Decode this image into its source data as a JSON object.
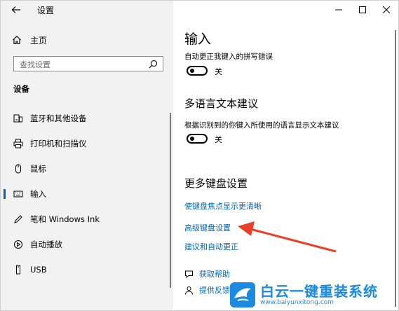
{
  "window": {
    "title": "设置",
    "controls": [
      "minimize-icon",
      "maximize-icon",
      "close-icon"
    ]
  },
  "sidebar": {
    "home_label": "主页",
    "search_placeholder": "查找设置",
    "section_title": "设备",
    "items": [
      {
        "label": "蓝牙和其他设备",
        "icon": "bluetooth-devices-icon"
      },
      {
        "label": "打印机和扫描仪",
        "icon": "printer-icon"
      },
      {
        "label": "鼠标",
        "icon": "mouse-icon"
      },
      {
        "label": "输入",
        "icon": "keyboard-icon",
        "active": true
      },
      {
        "label": "笔和 Windows Ink",
        "icon": "pen-icon"
      },
      {
        "label": "自动播放",
        "icon": "autoplay-icon"
      },
      {
        "label": "USB",
        "icon": "usb-icon"
      }
    ]
  },
  "main": {
    "page_title": "输入",
    "autocorrect": {
      "label": "自动更正我键入的拼写错误",
      "state_label": "关",
      "on": false
    },
    "multilingual": {
      "heading": "多语言文本建议",
      "label": "根据识别到的你键入所使用的语言显示文本建议",
      "state_label": "关",
      "on": false
    },
    "more_keyboard": {
      "heading": "更多键盘设置",
      "links": [
        "使键盘焦点显示更清晰",
        "高级键盘设置",
        "建议和自动更正"
      ]
    },
    "help": {
      "get_help": "获取帮助",
      "feedback": "提供反馈"
    }
  },
  "watermark": {
    "title": "白云一键重装系统",
    "url": "www.baiyunxitong.com"
  },
  "colors": {
    "accent": "#0063b1",
    "arrow": "#e8402a",
    "sidebar_bg": "#f2f2f2",
    "watermark": "#1d8ae2"
  }
}
